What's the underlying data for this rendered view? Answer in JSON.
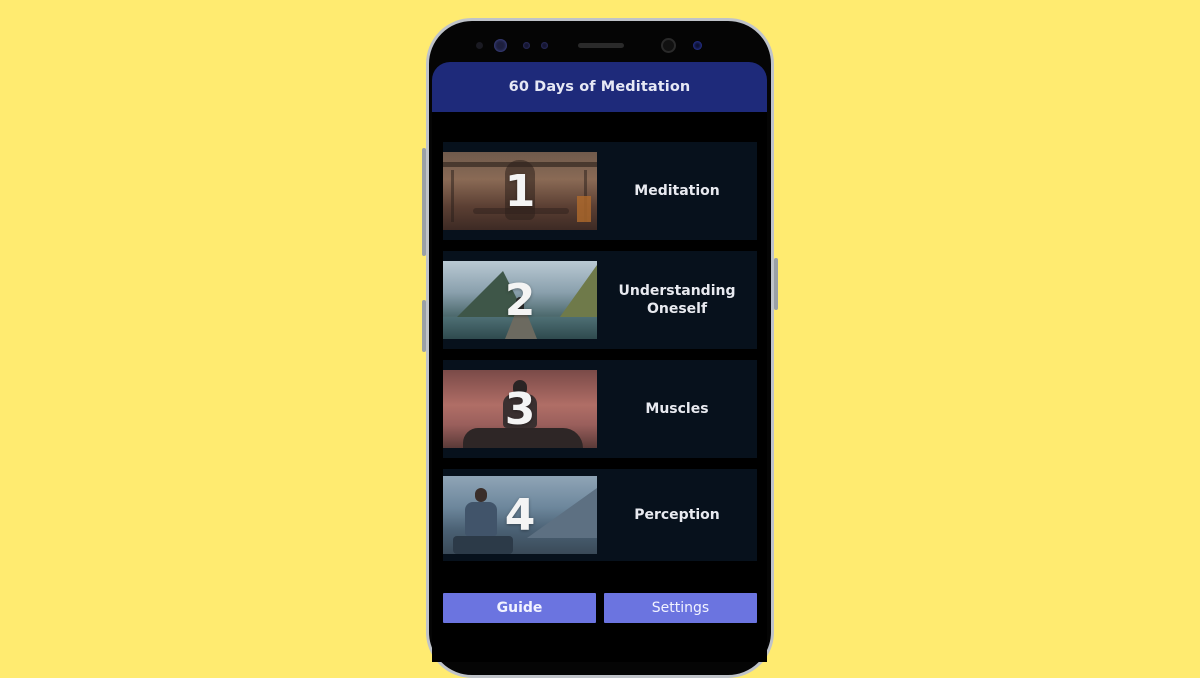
{
  "app": {
    "title": "60 Days of Meditation"
  },
  "lessons": [
    {
      "number": "1",
      "label": "Meditation"
    },
    {
      "number": "2",
      "label": "Understanding Oneself"
    },
    {
      "number": "3",
      "label": "Muscles"
    },
    {
      "number": "4",
      "label": "Perception"
    }
  ],
  "buttons": {
    "guide_label": "Guide",
    "settings_label": "Settings"
  },
  "colors": {
    "background": "#FFEB70",
    "header": "#1E2A7A",
    "card": "#07111C",
    "button": "#6B74E0"
  }
}
